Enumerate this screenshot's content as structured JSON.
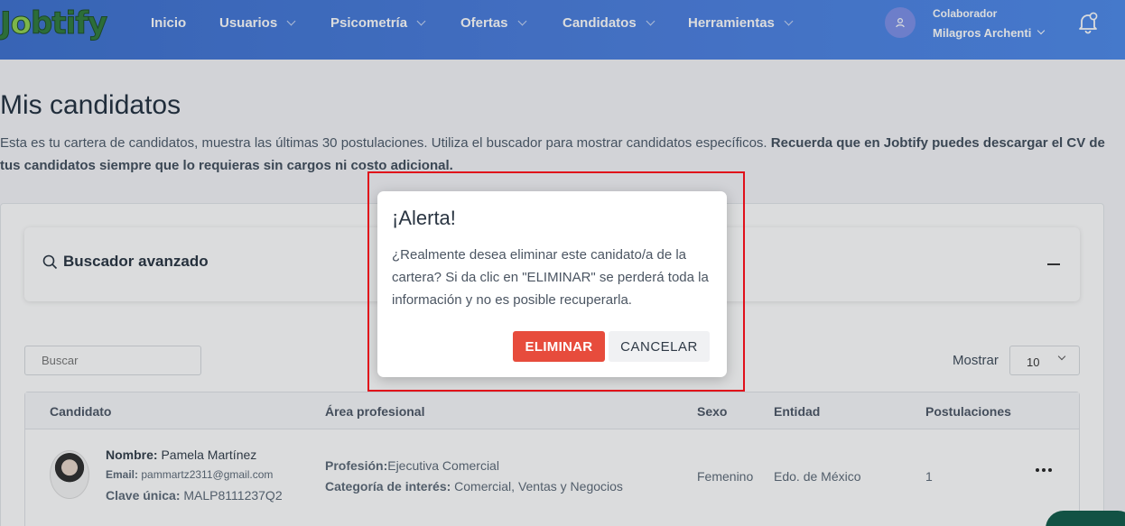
{
  "brand": {
    "logo_text": "Jobtify"
  },
  "nav": {
    "items": [
      {
        "label": "Inicio",
        "dropdown": false
      },
      {
        "label": "Usuarios",
        "dropdown": true
      },
      {
        "label": "Psicometría",
        "dropdown": true
      },
      {
        "label": "Ofertas",
        "dropdown": true
      },
      {
        "label": "Candidatos",
        "dropdown": true
      },
      {
        "label": "Herramientas",
        "dropdown": true
      }
    ],
    "user": {
      "role": "Colaborador",
      "name": "Milagros Archenti"
    }
  },
  "page": {
    "title": "Mis candidatos",
    "description_plain": "Esta es tu cartera de candidatos, muestra las últimas 30 postulaciones. Utiliza el buscador para mostrar candidatos específicos. ",
    "description_bold": "Recuerda que en Jobtify puedes descargar el CV de tus candidatos siempre que lo requieras sin cargos ni costo adicional."
  },
  "search_panel": {
    "title": "Buscador avanzado"
  },
  "controls": {
    "search_placeholder": "Buscar",
    "show_label": "Mostrar",
    "show_value": "10"
  },
  "table": {
    "headers": [
      "Candidato",
      "Área profesional",
      "Sexo",
      "Entidad",
      "Postulaciones"
    ],
    "rows": [
      {
        "name_label": "Nombre:",
        "name": "Pamela Martínez",
        "email_label": "Email:",
        "email": "pammartz2311@gmail.com",
        "key_label": "Clave única:",
        "key": "MALP8111237Q2",
        "profession_label": "Profesión:",
        "profession": "Ejecutiva Comercial",
        "category_label": "Categoría de interés:",
        "category": "Comercial, Ventas y Negocios",
        "sex": "Femenino",
        "entity": "Edo. de México",
        "applications": "1"
      }
    ]
  },
  "modal": {
    "title": "¡Alerta!",
    "body": "¿Realmente desea eliminar este canidato/a de la cartera? Si da clic en \"ELIMINAR\" se perderá toda la información y no es posible recuperarla.",
    "confirm_label": "ELIMINAR",
    "cancel_label": "CANCELAR"
  },
  "colors": {
    "nav_gradient_start": "#3b6fcf",
    "nav_gradient_end": "#4b88ea",
    "danger": "#e74c3c",
    "highlight_border": "#e0101a"
  }
}
